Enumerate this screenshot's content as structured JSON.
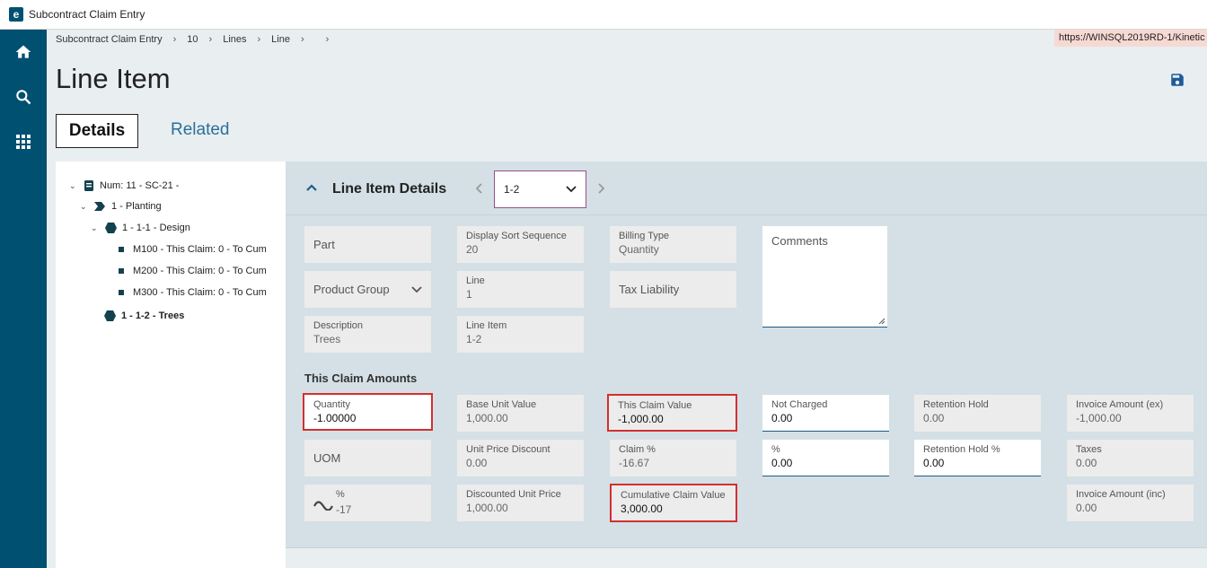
{
  "window": {
    "title": "Subcontract Claim Entry",
    "logo_letter": "e"
  },
  "url": "https://WINSQL2019RD-1/Kinetic",
  "breadcrumb": [
    "Subcontract Claim Entry",
    "10",
    "Lines",
    "Line",
    ""
  ],
  "page": {
    "title": "Line Item"
  },
  "tabs": {
    "details": "Details",
    "related": "Related"
  },
  "tree": [
    {
      "label": "Num: 11 - SC-21 -",
      "icon": "book-icon",
      "expanded": true
    },
    {
      "label": "1 - Planting",
      "icon": "chevron-tag-icon",
      "expanded": true
    },
    {
      "label": "1 - 1-1 - Design",
      "icon": "hexagon-icon",
      "expanded": true
    },
    {
      "label": "M100 - This Claim: 0 - To Cum",
      "icon": "square-bullet-icon"
    },
    {
      "label": "M200 - This Claim: 0 - To Cum",
      "icon": "square-bullet-icon"
    },
    {
      "label": "M300 - This Claim: 0 - To Cum",
      "icon": "square-bullet-icon"
    },
    {
      "label": "1 - 1-2 - Trees",
      "icon": "hexagon-icon",
      "selected": true
    }
  ],
  "panel": {
    "title": "Line Item Details",
    "record": "1-2",
    "part_label": "Part",
    "display_sort_label": "Display Sort Sequence",
    "display_sort_value": "20",
    "billing_type_label": "Billing Type",
    "billing_type_value": "Quantity",
    "comments_label": "Comments",
    "product_group_label": "Product Group",
    "line_label": "Line",
    "line_value": "1",
    "tax_liability_label": "Tax Liability",
    "description_label": "Description",
    "description_value": "Trees",
    "line_item_label": "Line Item",
    "line_item_value": "1-2"
  },
  "claim": {
    "section_title": "This Claim Amounts",
    "quantity_label": "Quantity",
    "quantity_value": "-1.00000",
    "uom_label": "UOM",
    "pct_label": "%",
    "pct_value": "-17",
    "base_unit_value_label": "Base Unit Value",
    "base_unit_value": "1,000.00",
    "unit_price_discount_label": "Unit Price Discount",
    "unit_price_discount_value": "0.00",
    "discounted_unit_price_label": "Discounted Unit Price",
    "discounted_unit_price_value": "1,000.00",
    "this_claim_value_label": "This Claim Value",
    "this_claim_value": "-1,000.00",
    "claim_pct_label": "Claim %",
    "claim_pct_value": "-16.67",
    "cumulative_claim_label": "Cumulative Claim Value",
    "cumulative_claim_value": "3,000.00",
    "not_charged_label": "Not Charged",
    "not_charged_value": "0.00",
    "percent_label": "%",
    "percent_value": "0.00",
    "retention_hold_label": "Retention Hold",
    "retention_hold_value": "0.00",
    "retention_hold_pct_label": "Retention Hold %",
    "retention_hold_pct_value": "0.00",
    "invoice_ex_label": "Invoice Amount (ex)",
    "invoice_ex_value": "-1,000.00",
    "taxes_label": "Taxes",
    "taxes_value": "0.00",
    "invoice_inc_label": "Invoice Amount (inc)",
    "invoice_inc_value": "0.00"
  },
  "colors": {
    "rail": "#005071",
    "panel": "#d4e0e5",
    "highlight_border": "#d32f2f",
    "link": "#2a6f9b"
  }
}
